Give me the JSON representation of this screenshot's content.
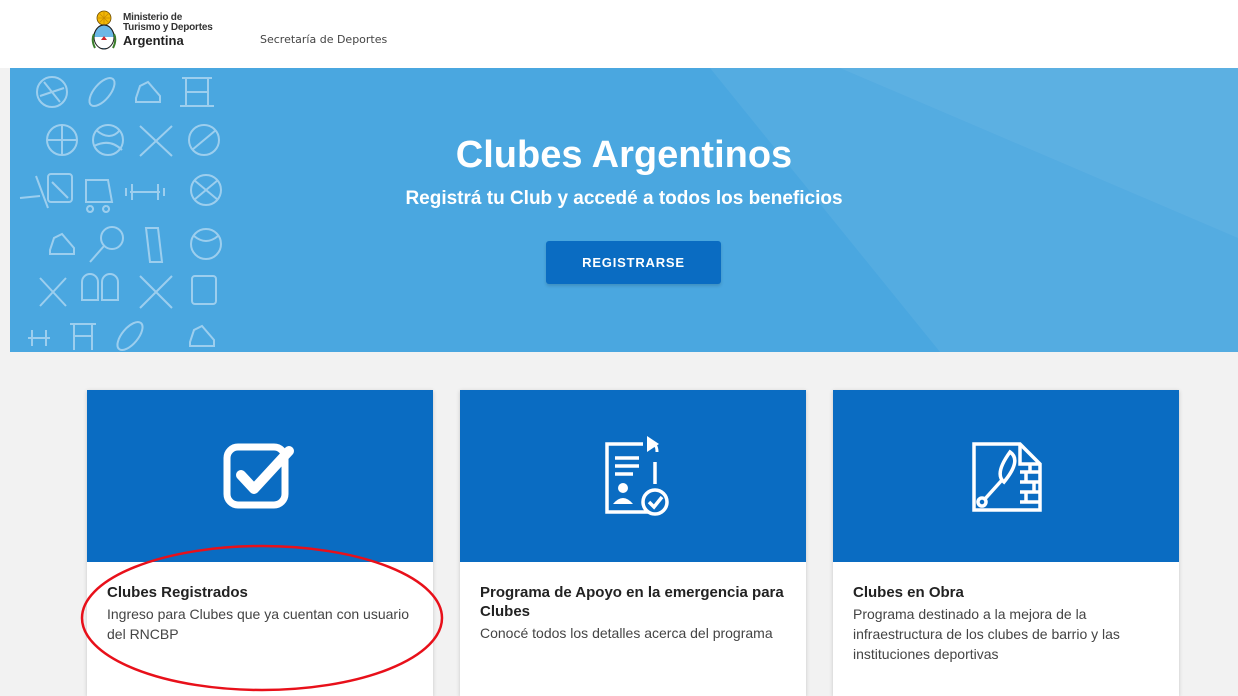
{
  "header": {
    "logo_line1": "Ministerio de",
    "logo_line2": "Turismo y Deportes",
    "logo_line3": "Argentina",
    "secretaria": "Secretaría de Deportes"
  },
  "hero": {
    "title": "Clubes Argentinos",
    "subtitle": "Registrá tu Club y accedé a todos los beneficios",
    "button_label": "REGISTRARSE",
    "background_color": "#4aa7e0",
    "button_color": "#0a6cc2"
  },
  "cards": [
    {
      "icon": "checkbox-icon",
      "title": "Clubes Registrados",
      "description": "Ingreso para Clubes que ya cuentan con usuario del RNCBP"
    },
    {
      "icon": "document-approval-icon",
      "title": "Programa de Apoyo en la emergencia para Clubes",
      "description": "Conocé todos los detalles acerca del programa"
    },
    {
      "icon": "construction-trowel-icon",
      "title": "Clubes en Obra",
      "description": "Programa destinado a la mejora de la infraestructura de los clubes de barrio y las instituciones deportivas"
    }
  ],
  "annotation": {
    "color": "#e8101a"
  }
}
